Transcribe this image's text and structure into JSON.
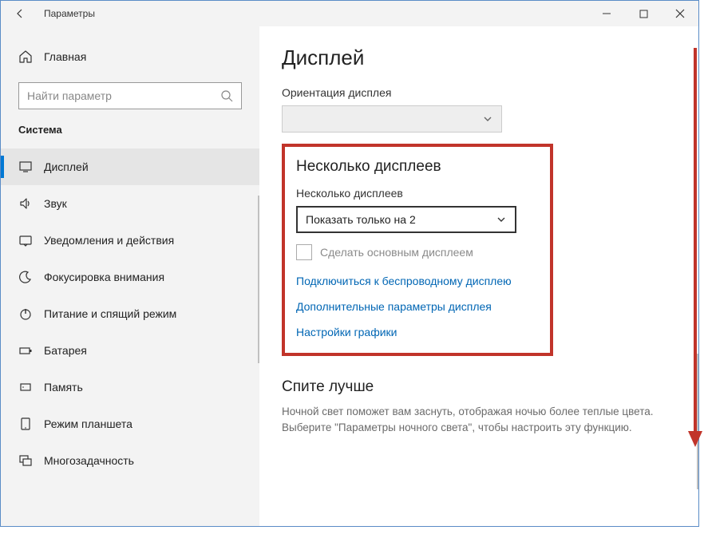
{
  "titlebar": {
    "title": "Параметры"
  },
  "sidebar": {
    "home": "Главная",
    "search_placeholder": "Найти параметр",
    "category": "Система",
    "items": [
      {
        "label": "Дисплей"
      },
      {
        "label": "Звук"
      },
      {
        "label": "Уведомления и действия"
      },
      {
        "label": "Фокусировка внимания"
      },
      {
        "label": "Питание и спящий режим"
      },
      {
        "label": "Батарея"
      },
      {
        "label": "Память"
      },
      {
        "label": "Режим планшета"
      },
      {
        "label": "Многозадачность"
      }
    ]
  },
  "main": {
    "title": "Дисплей",
    "orientation_label": "Ориентация дисплея",
    "multi_section_title": "Несколько дисплеев",
    "multi_label": "Несколько дисплеев",
    "multi_selected": "Показать только на 2",
    "make_main_label": "Сделать основным дисплеем",
    "link_wireless": "Подключиться к беспроводному дисплею",
    "link_advanced": "Дополнительные параметры дисплея",
    "link_graphics": "Настройки графики",
    "sleep_title": "Спите лучше",
    "sleep_text": "Ночной свет поможет вам заснуть, отображая ночью более теплые цвета. Выберите \"Параметры ночного света\", чтобы настроить эту функцию."
  }
}
